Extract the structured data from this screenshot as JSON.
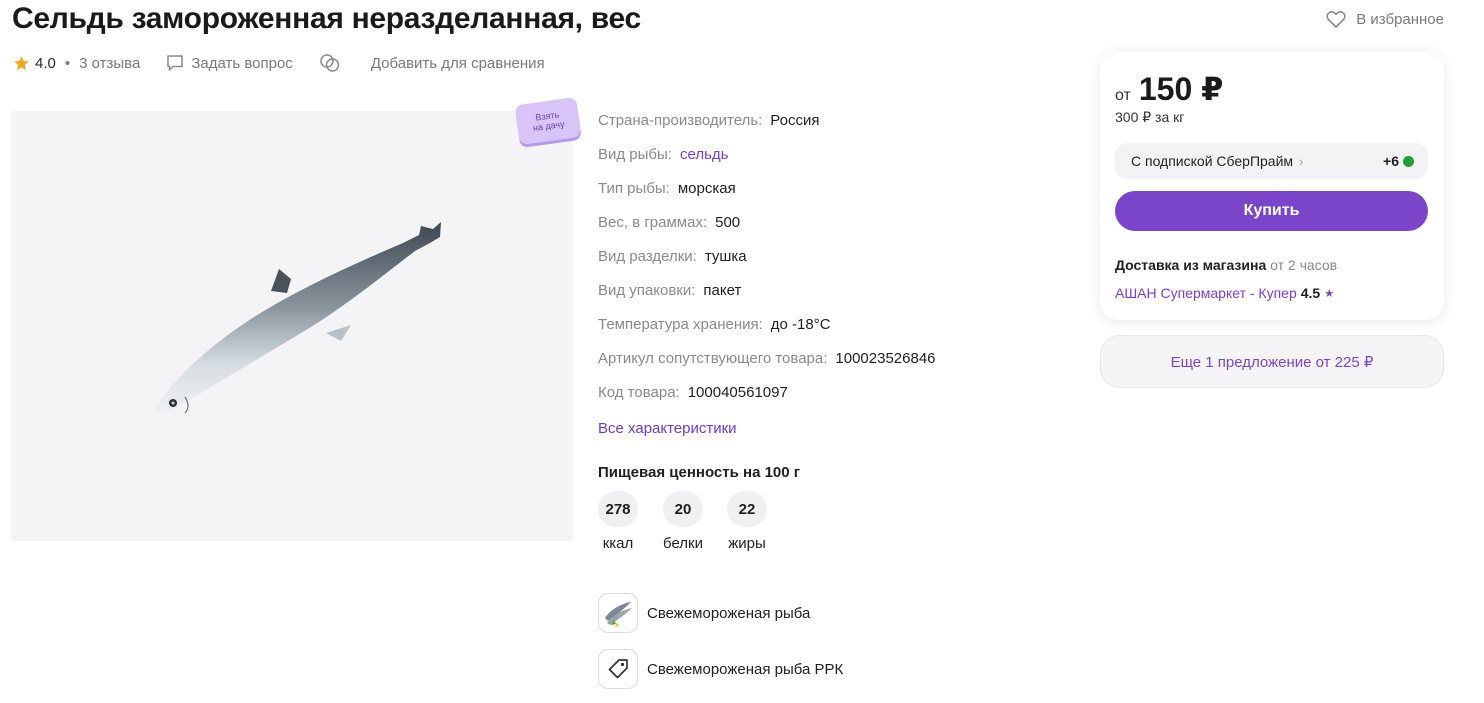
{
  "product": {
    "title": "Сельдь замороженная неразделанная, вес",
    "favorite_label": "В избранное",
    "rating": "4.0",
    "reviews": "3 отзыва",
    "ask_label": "Задать вопрос",
    "compare_label": "Добавить для сравнения",
    "badge_line1": "Взять",
    "badge_line2": "на дачу"
  },
  "specs": [
    {
      "key": "Страна-производитель:",
      "value": "Россия"
    },
    {
      "key": "Вид рыбы:",
      "value": "сельдь"
    },
    {
      "key": "Тип рыбы:",
      "value": "морская"
    },
    {
      "key": "Вес, в граммах:",
      "value": "500"
    },
    {
      "key": "Вид разделки:",
      "value": "тушка"
    },
    {
      "key": "Вид упаковки:",
      "value": "пакет"
    },
    {
      "key": "Температура хранения:",
      "value": "до -18°С"
    },
    {
      "key": "Артикул сопутствующего товара:",
      "value": "100023526846"
    },
    {
      "key": "Код товара:",
      "value": "100040561097"
    }
  ],
  "all_specs_label": "Все характеристики",
  "nutrition": {
    "title": "Пищевая ценность на 100 г",
    "items": [
      {
        "value": "278",
        "label": "ккал"
      },
      {
        "value": "20",
        "label": "белки"
      },
      {
        "value": "22",
        "label": "жиры"
      }
    ]
  },
  "categories": [
    {
      "label": "Свежемороженая рыба",
      "icon": "fish-thumbnail-icon"
    },
    {
      "label": "Свежемороженая рыба РРК",
      "icon": "tag-icon"
    }
  ],
  "buybox": {
    "price_prefix": "от",
    "price": "150 ₽",
    "price_per_kg": "300 ₽ за кг",
    "prime_label": "С подпиской СберПрайм",
    "prime_bonus": "+6",
    "buy_label": "Купить",
    "delivery_label": "Доставка из магазина",
    "delivery_time": "от 2 часов",
    "store_name": "АШАН Супермаркет - Купер",
    "store_rating": "4.5"
  },
  "more_offers_label": "Еще 1 предложение от 225 ₽",
  "colors": {
    "accent": "#7b45c9",
    "link": "#7a3fd1",
    "star": "#f5a623",
    "bonus": "#21a038"
  }
}
